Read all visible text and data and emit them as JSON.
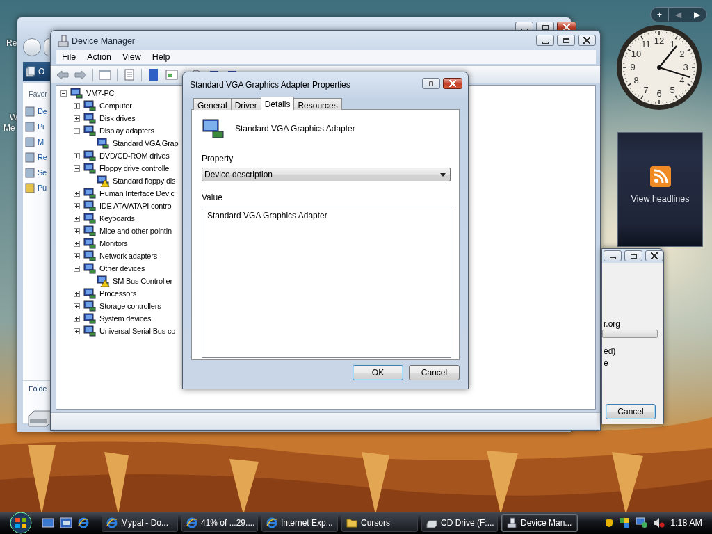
{
  "desktop_icons": [
    {
      "label": "Re"
    },
    {
      "label": "W"
    },
    {
      "label": "Me"
    }
  ],
  "explorer_window": {
    "band_text": "O",
    "pane_header": "Favor",
    "pane_items": [
      "De",
      "Pi",
      "M",
      "Re",
      "Se",
      "Pu"
    ],
    "folders_label": "Folde"
  },
  "device_manager": {
    "title": "Device Manager",
    "menu": [
      "File",
      "Action",
      "View",
      "Help"
    ],
    "tree": {
      "label": "VM7-PC",
      "expanded": true,
      "children": [
        {
          "label": "Computer",
          "expanded": false
        },
        {
          "label": "Disk drives",
          "expanded": false
        },
        {
          "label": "Display adapters",
          "expanded": true,
          "children": [
            {
              "label": "Standard VGA Grap",
              "warning": false
            }
          ]
        },
        {
          "label": "DVD/CD-ROM drives",
          "expanded": false
        },
        {
          "label": "Floppy drive controlle",
          "expanded": true,
          "children": [
            {
              "label": "Standard floppy dis",
              "warning": true
            }
          ]
        },
        {
          "label": "Human Interface Devic",
          "expanded": false
        },
        {
          "label": "IDE ATA/ATAPI contro",
          "expanded": false
        },
        {
          "label": "Keyboards",
          "expanded": false
        },
        {
          "label": "Mice and other pointin",
          "expanded": false
        },
        {
          "label": "Monitors",
          "expanded": false
        },
        {
          "label": "Network adapters",
          "expanded": false
        },
        {
          "label": "Other devices",
          "expanded": true,
          "children": [
            {
              "label": "SM Bus Controller",
              "warning": true
            }
          ]
        },
        {
          "label": "Processors",
          "expanded": false
        },
        {
          "label": "Storage controllers",
          "expanded": false
        },
        {
          "label": "System devices",
          "expanded": false
        },
        {
          "label": "Universal Serial Bus co",
          "expanded": false
        }
      ]
    }
  },
  "properties_dialog": {
    "title": "Standard VGA Graphics Adapter Properties",
    "tabs": [
      {
        "label": "General",
        "selected": false
      },
      {
        "label": "Driver",
        "selected": false
      },
      {
        "label": "Details",
        "selected": true
      },
      {
        "label": "Resources",
        "selected": false
      }
    ],
    "device_name": "Standard VGA Graphics Adapter",
    "property_label": "Property",
    "property_value": "Device description",
    "value_label": "Value",
    "values": [
      "Standard VGA Graphics Adapter"
    ],
    "buttons": [
      "OK",
      "Cancel"
    ]
  },
  "download_window": {
    "text_above": "r.org",
    "progress": {
      "level": 0
    },
    "texts_below": [
      "ed)",
      "e"
    ],
    "button": "Cancel"
  },
  "sidebar": {
    "controls": [
      "+",
      "◀",
      "▶"
    ],
    "clock_numbers": [
      "12",
      "11",
      "1",
      "10",
      "2",
      "9",
      "3",
      "8",
      "4",
      "7",
      "5",
      "6"
    ],
    "feed_label": "View headlines"
  },
  "taskbar": {
    "tasks": [
      {
        "label": "Mypal - Do...",
        "kind": "browser",
        "selected": false
      },
      {
        "label": "41% of ...29....",
        "kind": "browser",
        "selected": false
      },
      {
        "label": "Internet Exp...",
        "kind": "browser",
        "selected": false
      },
      {
        "label": "Cursors",
        "kind": "folder",
        "selected": false
      },
      {
        "label": "CD Drive (F:...",
        "kind": "drive",
        "selected": false
      },
      {
        "label": "Device Man...",
        "kind": "devices",
        "selected": true
      }
    ],
    "clock": "1:18 AM"
  }
}
